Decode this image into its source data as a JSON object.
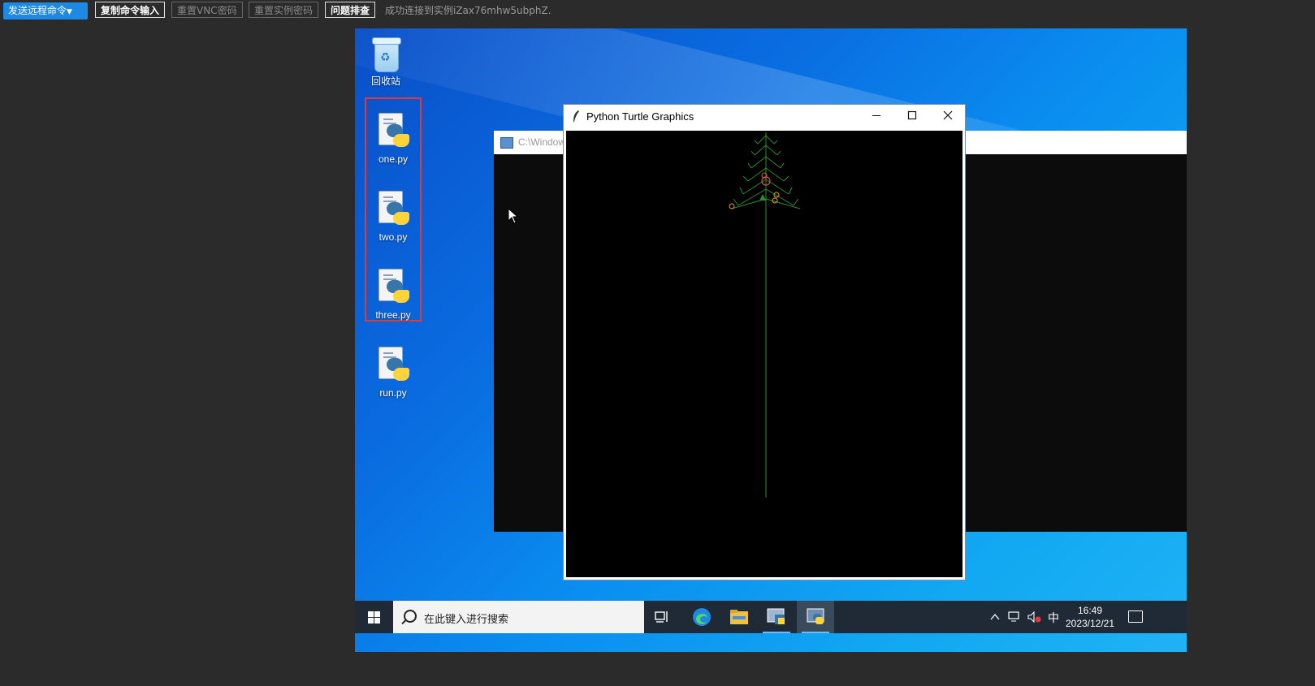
{
  "toolbar": {
    "send_command_label": "发送远程命令",
    "copy_input_label": "复制命令输入",
    "reset_vnc_label": "重置VNC密码",
    "reset_instance_label": "重置实例密码",
    "troubleshoot_label": "问题排查",
    "status_text": "成功连接到实例iZax76mhw5ubphZ."
  },
  "desktop": {
    "icons": [
      {
        "label": "回收站"
      },
      {
        "label": "one.py"
      },
      {
        "label": "two.py"
      },
      {
        "label": "three.py"
      },
      {
        "label": "run.py"
      }
    ]
  },
  "console_window": {
    "title": "C:\\Window"
  },
  "turtle_window": {
    "title": "Python Turtle Graphics"
  },
  "taskbar": {
    "search_placeholder": "在此键入进行搜索",
    "ime_label": "中",
    "time": "16:49",
    "date": "2023/12/21"
  },
  "colors": {
    "accent": "#1e88e5",
    "selection": "#e53935",
    "tree_green": "#2e8b2e",
    "ornament_red": "#e05050",
    "ornament_orange": "#e0a030"
  }
}
